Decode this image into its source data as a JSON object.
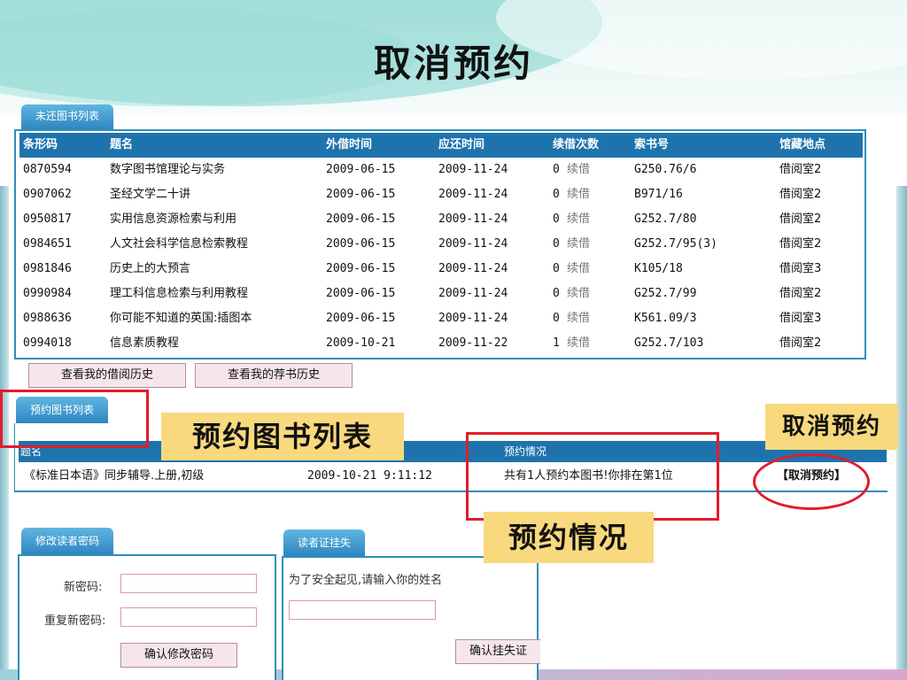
{
  "slide": {
    "title": "取消预约"
  },
  "loans": {
    "tab_label": "未还图书列表",
    "columns": [
      "条形码",
      "题名",
      "外借时间",
      "应还时间",
      "续借次数",
      "索书号",
      "馆藏地点"
    ],
    "rows": [
      {
        "barcode": "0870594",
        "title": "数字图书馆理论与实务",
        "out": "2009-06-15",
        "due": "2009-11-24",
        "renew_count": "0",
        "renew": "续借",
        "call_no": "G250.76/6",
        "location": "借阅室2"
      },
      {
        "barcode": "0907062",
        "title": "圣经文学二十讲",
        "out": "2009-06-15",
        "due": "2009-11-24",
        "renew_count": "0",
        "renew": "续借",
        "call_no": "B971/16",
        "location": "借阅室2"
      },
      {
        "barcode": "0950817",
        "title": "实用信息资源检索与利用",
        "out": "2009-06-15",
        "due": "2009-11-24",
        "renew_count": "0",
        "renew": "续借",
        "call_no": "G252.7/80",
        "location": "借阅室2"
      },
      {
        "barcode": "0984651",
        "title": "人文社会科学信息检索教程",
        "out": "2009-06-15",
        "due": "2009-11-24",
        "renew_count": "0",
        "renew": "续借",
        "call_no": "G252.7/95(3)",
        "location": "借阅室2"
      },
      {
        "barcode": "0981846",
        "title": "历史上的大预言",
        "out": "2009-06-15",
        "due": "2009-11-24",
        "renew_count": "0",
        "renew": "续借",
        "call_no": "K105/18",
        "location": "借阅室3"
      },
      {
        "barcode": "0990984",
        "title": "理工科信息检索与利用教程",
        "out": "2009-06-15",
        "due": "2009-11-24",
        "renew_count": "0",
        "renew": "续借",
        "call_no": "G252.7/99",
        "location": "借阅室2"
      },
      {
        "barcode": "0988636",
        "title": "你可能不知道的英国:插图本",
        "out": "2009-06-15",
        "due": "2009-11-24",
        "renew_count": "0",
        "renew": "续借",
        "call_no": "K561.09/3",
        "location": "借阅室3"
      },
      {
        "barcode": "0994018",
        "title": "信息素质教程",
        "out": "2009-10-21",
        "due": "2009-11-22",
        "renew_count": "1",
        "renew": "续借",
        "call_no": "G252.7/103",
        "location": "借阅室2"
      }
    ],
    "history_button": "查看我的借阅历史",
    "recommend_button": "查看我的荐书历史"
  },
  "reservations": {
    "tab_label": "预约图书列表",
    "columns": [
      "题名",
      "",
      "预约情况",
      ""
    ],
    "row": {
      "title": "《标准日本语》同步辅导.上册,初级",
      "time": "2009-10-21 9:11:12",
      "status": "共有1人预约本图书!你排在第1位",
      "cancel": "【取消预约】"
    }
  },
  "password": {
    "tab_label": "修改读者密码",
    "new_label": "新密码:",
    "repeat_label": "重复新密码:",
    "new_value": "",
    "repeat_value": "",
    "confirm_button": "确认修改密码"
  },
  "report_loss": {
    "tab_label": "读者证挂失",
    "hint": "为了安全起见,请输入你的姓名",
    "name_value": "",
    "confirm_button": "确认挂失证"
  },
  "annotations": {
    "reservation_list": "预约图书列表",
    "cancel": "取消预约",
    "status": "预约情况",
    "accent_color": "#e11d2a",
    "callout_color": "#f9d97e"
  },
  "colors": {
    "header_blue": "#1f73ad",
    "border_blue": "#2f8fb8"
  }
}
